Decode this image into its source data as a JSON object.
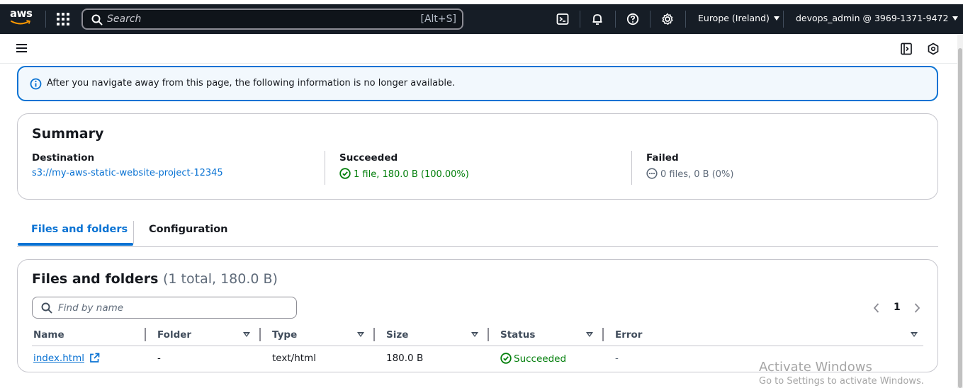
{
  "topnav": {
    "logo": "aws",
    "search_placeholder": "Search",
    "search_shortcut": "[Alt+S]",
    "region": "Europe (Ireland)",
    "account": "devops_admin @ 3969-1371-9472",
    "icons": [
      "cloudshell-icon",
      "bell-icon",
      "help-icon",
      "gear-icon"
    ]
  },
  "alert": {
    "message": "After you navigate away from this page, the following information is no longer available."
  },
  "summary": {
    "title": "Summary",
    "destination_label": "Destination",
    "destination_value": "s3://my-aws-static-website-project-12345",
    "succeeded_label": "Succeeded",
    "succeeded_value": "1 file, 180.0 B (100.00%)",
    "failed_label": "Failed",
    "failed_value": "0 files, 0 B (0%)"
  },
  "tabs": [
    {
      "label": "Files and folders",
      "active": true
    },
    {
      "label": "Configuration",
      "active": false
    }
  ],
  "files": {
    "title": "Files and folders",
    "count": "(1 total, 180.0 B)",
    "find_placeholder": "Find by name",
    "page": "1",
    "columns": [
      "Name",
      "Folder",
      "Type",
      "Size",
      "Status",
      "Error"
    ],
    "rows": [
      {
        "name": "index.html",
        "folder": "-",
        "type": "text/html",
        "size": "180.0 B",
        "status": "Succeeded",
        "error": "-"
      }
    ]
  },
  "watermark": {
    "line1": "Activate Windows",
    "line2": "Go to Settings to activate Windows."
  },
  "colors": {
    "nav_bg": "#161d26",
    "link": "#0972d3",
    "success": "#037f0c",
    "border": "#c6c6cd"
  }
}
